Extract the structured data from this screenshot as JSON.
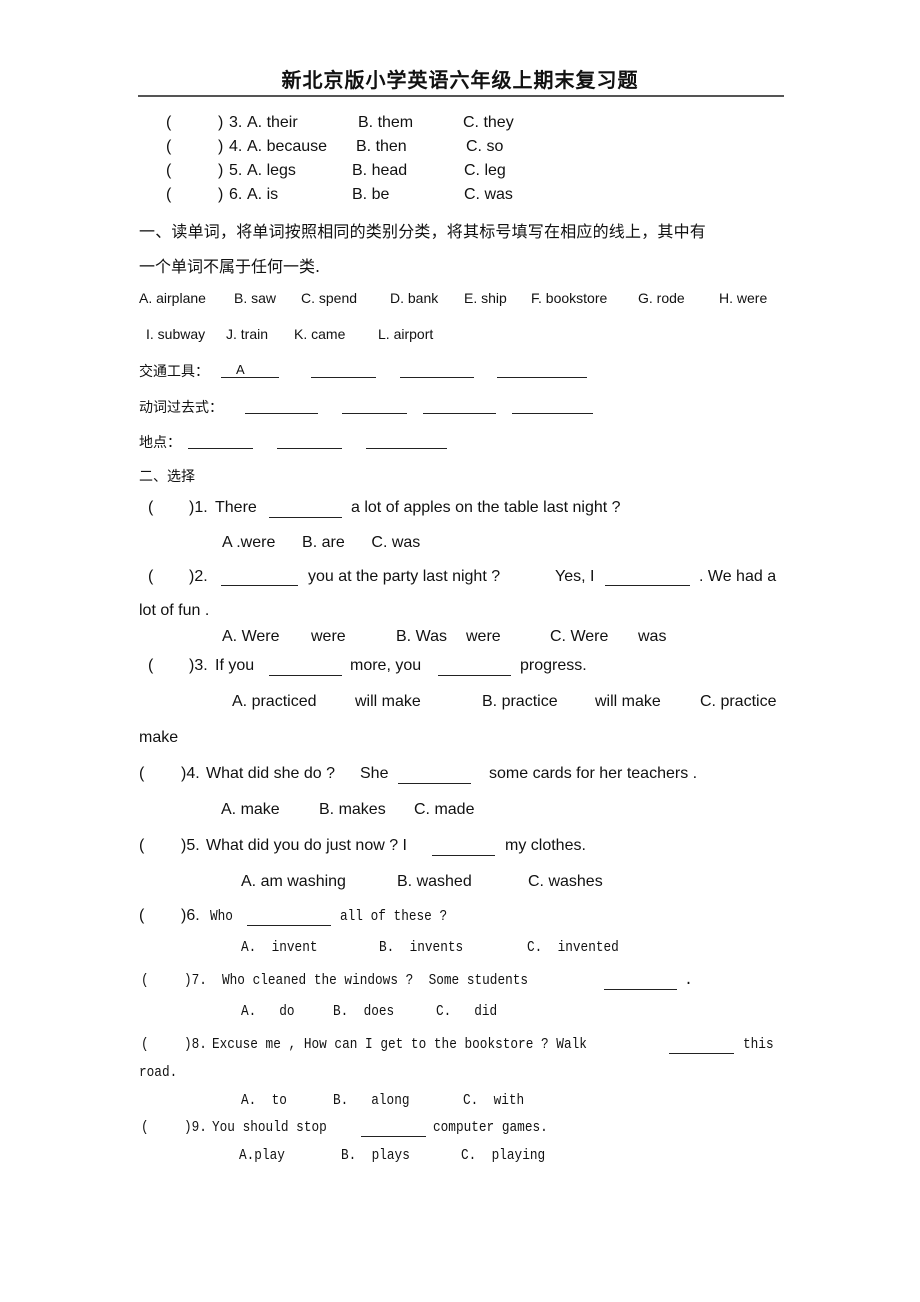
{
  "title": "新北京版小学英语六年级上期末复习题",
  "prev_section": {
    "items": [
      {
        "paren_open": "(",
        "paren_close": ")",
        "num": "3.",
        "a": "A. their",
        "b": "B. them",
        "c": "C. they"
      },
      {
        "paren_open": "(",
        "paren_close": ")",
        "num": "4.",
        "a": "A. because",
        "b": "B. then",
        "c": "C. so"
      },
      {
        "paren_open": "(",
        "paren_close": ")",
        "num": "5.",
        "a": "A. legs",
        "b": "B. head",
        "c": "C. leg"
      },
      {
        "paren_open": "(",
        "paren_close": ")",
        "num": "6.",
        "a": "A. is",
        "b": "B. be",
        "c": "C. was"
      }
    ]
  },
  "section1": {
    "instruction_line1": "一、读单词，将单词按照相同的类别分类，将其标号填写在相应的线上，其中有",
    "instruction_line2": "一个单词不属于任何一类.",
    "words_row1": [
      "A. airplane",
      "B. saw",
      "C. spend",
      "D. bank",
      "E. ship",
      "F. bookstore",
      "G. rode",
      "H. were"
    ],
    "words_row2": [
      "I. subway",
      "J. train",
      "K. came",
      "L. airport"
    ],
    "categories": [
      {
        "label": "交通工具：",
        "filled": "A"
      },
      {
        "label": "动词过去式：",
        "filled": ""
      },
      {
        "label": "地点：",
        "filled": ""
      }
    ]
  },
  "section2": {
    "heading": "二、选择",
    "q1": {
      "paren": "(",
      "close": ")1.",
      "pre": "There",
      "post": "a lot of apples on the table last night ?",
      "options": "A .were      B. are      C. was"
    },
    "q2": {
      "paren": "(",
      "close": ")2.",
      "mid": "you at the party last night ?",
      "yes": "Yes, I",
      "post": ". We had a",
      "cont": "lot of fun .",
      "opt_a1": "A. Were",
      "opt_a2": "were",
      "opt_b1": "B. Was",
      "opt_b2": "were",
      "opt_c1": "C. Were",
      "opt_c2": "was"
    },
    "q3": {
      "paren": "(",
      "close": ")3.",
      "pre": "If you",
      "mid": "more, you",
      "post": "progress.",
      "opt_a1": "A. practiced",
      "opt_a2": "will make",
      "opt_b1": "B. practice",
      "opt_b2": "will make",
      "opt_c1": "C. practice",
      "cont": "make"
    },
    "q4": {
      "paren": "(",
      "close": ")4.",
      "pre": "What did she do ?",
      "she": "She",
      "post": "some cards for her teachers .",
      "opt_a": "A. make",
      "opt_b": "B. makes",
      "opt_c": "C. made"
    },
    "q5": {
      "paren": "(",
      "close": ")5.",
      "pre": "What did you do just now ? I",
      "post": "my clothes.",
      "opt_a": "A. am washing",
      "opt_b": "B. washed",
      "opt_c": "C. washes"
    },
    "q6": {
      "paren": "(",
      "close": ")6.",
      "pre": "Who",
      "post": "all of these ?",
      "opt_a": "A.  invent",
      "opt_b": "B.  invents",
      "opt_c": "C.  invented"
    },
    "q7": {
      "paren": "(",
      "close": ")7.",
      "pre": "Who cleaned the windows ?  Some students",
      "post": ".",
      "opt_a": "A.   do",
      "opt_b": "B.  does",
      "opt_c": "C.   did"
    },
    "q8": {
      "paren": "(",
      "close": ")8.",
      "pre": "Excuse me , How can I get to the bookstore ? Walk",
      "post": "this",
      "cont": "road.",
      "opt_a": "A.  to",
      "opt_b": "B.   along",
      "opt_c": "C.  with"
    },
    "q9": {
      "paren": "(",
      "close": ")9.",
      "pre": "You should stop",
      "post": "computer games.",
      "opt_a": "A.play",
      "opt_b": "B.  plays",
      "opt_c": "C.  playing"
    }
  }
}
